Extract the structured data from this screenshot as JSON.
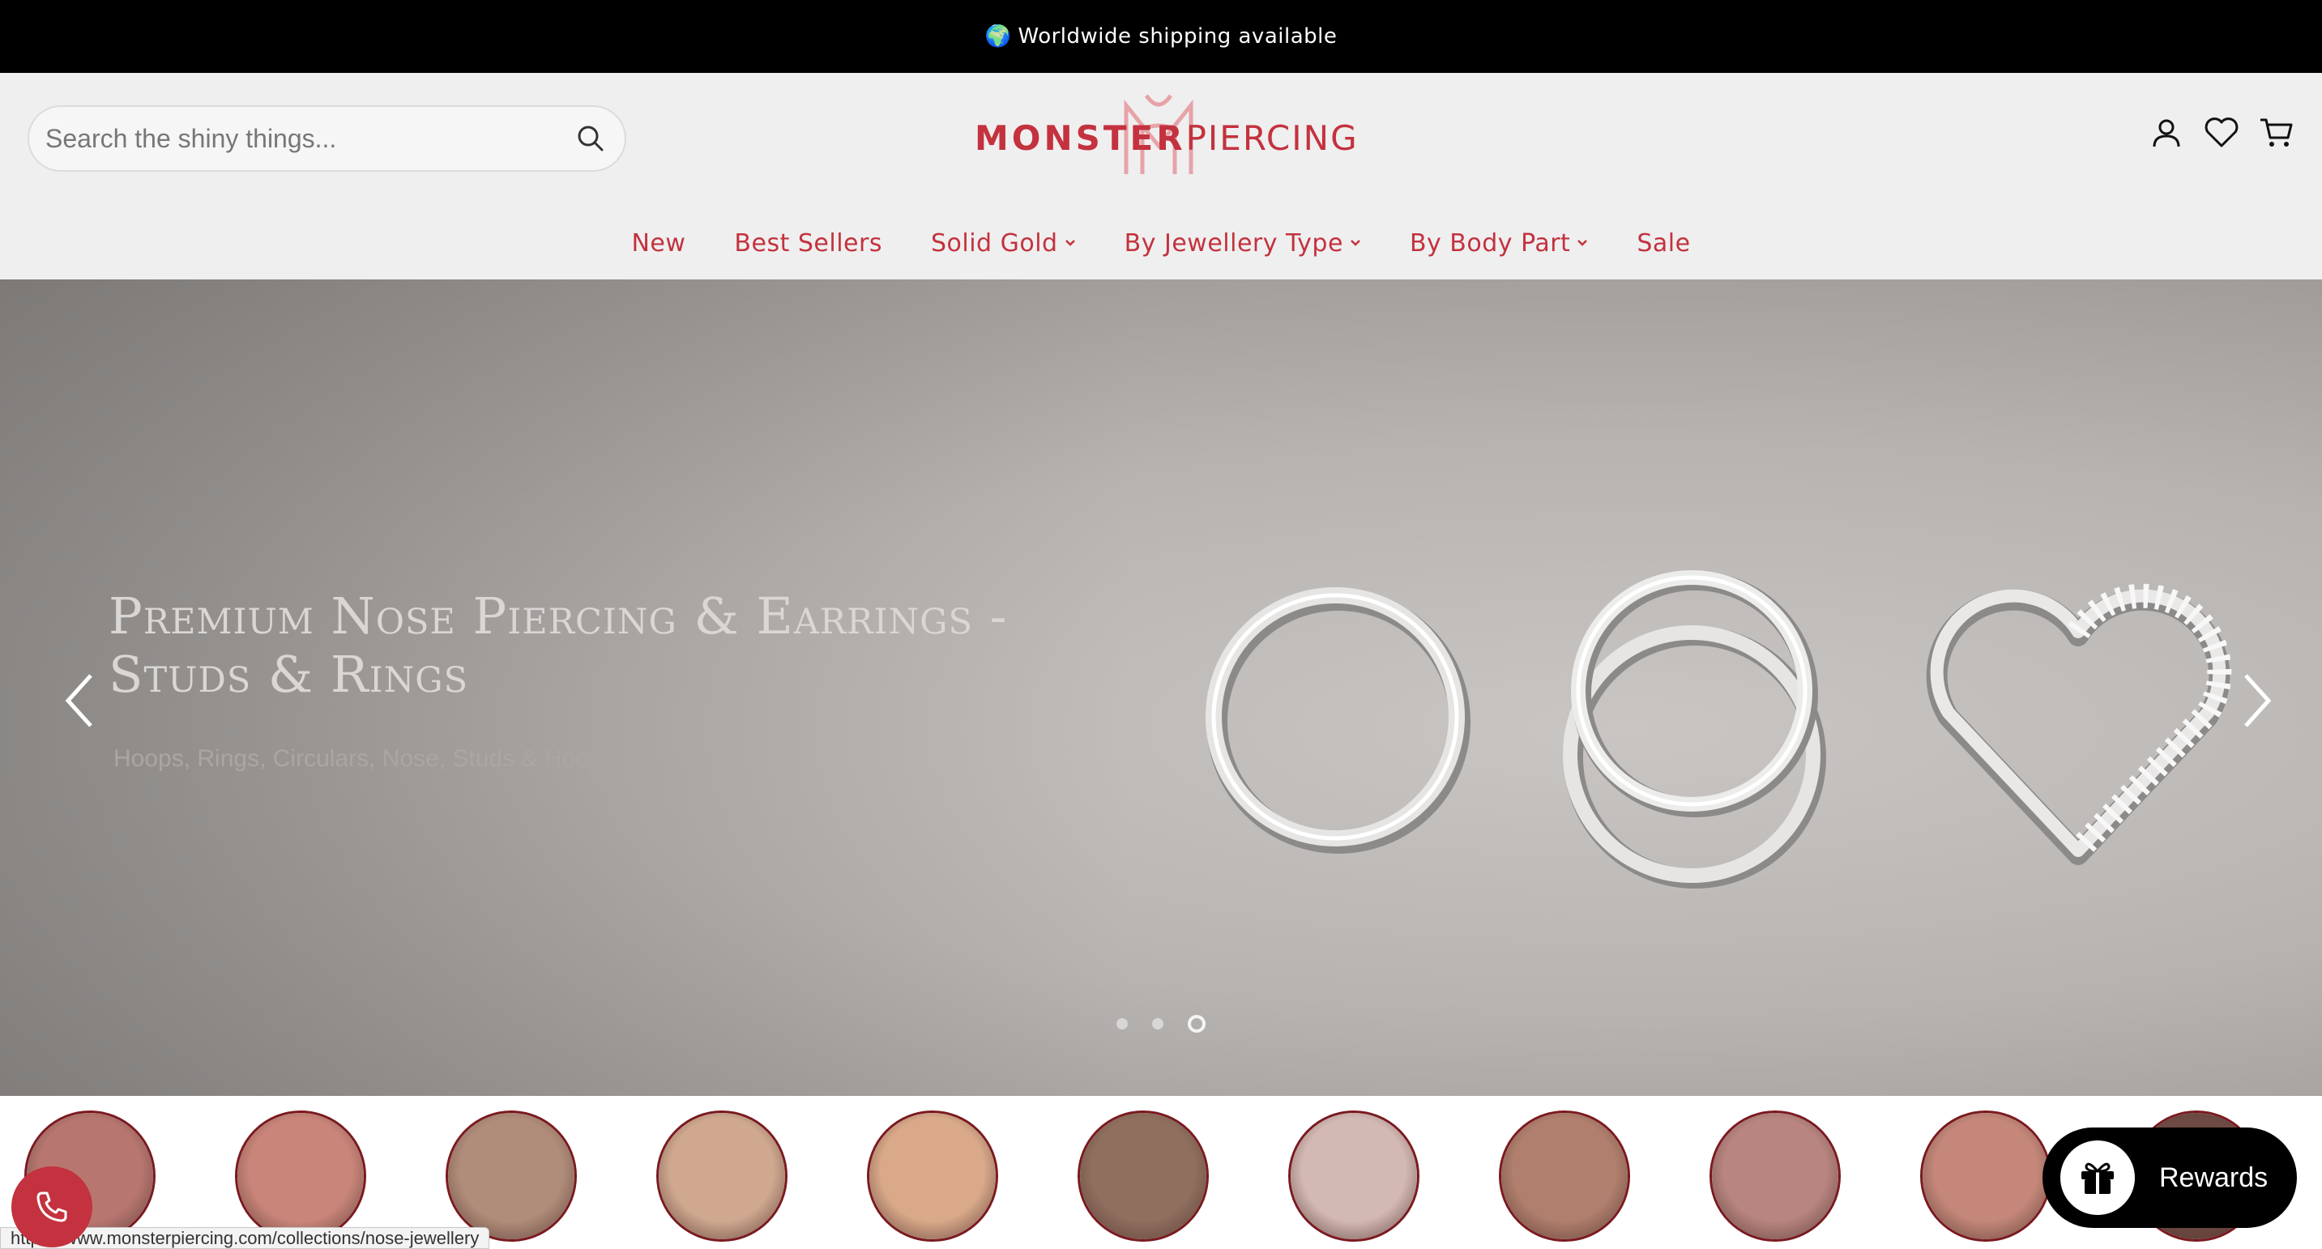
{
  "announcement": {
    "icon": "globe-icon",
    "text": "Worldwide shipping available"
  },
  "search": {
    "placeholder": "Search the shiny things...",
    "icon": "search-icon"
  },
  "logo": {
    "bold_text": "MONSTER",
    "light_text": "PIERCING",
    "color": "#c3323e"
  },
  "header_icons": [
    "account-icon",
    "wishlist-heart-icon",
    "cart-icon"
  ],
  "nav": {
    "items": [
      {
        "label": "New",
        "dropdown": false
      },
      {
        "label": "Best Sellers",
        "dropdown": false
      },
      {
        "label": "Solid Gold",
        "dropdown": true
      },
      {
        "label": "By Jewellery Type",
        "dropdown": true
      },
      {
        "label": "By Body Part",
        "dropdown": true
      },
      {
        "label": "Sale",
        "dropdown": false
      }
    ]
  },
  "hero": {
    "title_line1": "Premium Nose Piercing & Earrings -",
    "title_line2": "Studs & Rings",
    "subtitle": "Hoops, Rings, Circulars, Nose, Studs & Hoops",
    "slide_count": 3,
    "active_slide": 3
  },
  "thumbnails": [
    {
      "name": "tongue-piercing",
      "color": "#b77670"
    },
    {
      "name": "lip-ring",
      "color": "#c98579"
    },
    {
      "name": "ear-helix",
      "color": "#b08d7a"
    },
    {
      "name": "eyebrow-piercing",
      "color": "#cfa88f"
    },
    {
      "name": "navel-piercing",
      "color": "#d9a98a"
    },
    {
      "name": "ear-lobe",
      "color": "#8f6f5e"
    },
    {
      "name": "face-stud",
      "color": "#d3b9b4"
    },
    {
      "name": "septum-ring",
      "color": "#b07f6d"
    },
    {
      "name": "snake-bites",
      "color": "#b88580"
    },
    {
      "name": "lip-hoop",
      "color": "#c48779"
    },
    {
      "name": "partial-thumb",
      "color": "#6d4a43"
    }
  ],
  "status_bar": {
    "url": "https://www.monsterpiercing.com/collections/nose-jewellery"
  },
  "rewards": {
    "label": "Rewards",
    "icon": "gift-icon"
  },
  "phone_button": {
    "icon": "phone-icon"
  }
}
